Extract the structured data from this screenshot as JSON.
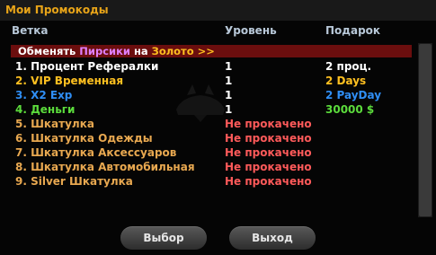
{
  "title": "Мои Промокоды",
  "columns": [
    "Ветка",
    "Уровень",
    "Подарок"
  ],
  "promo": {
    "prefix": "Обменять ",
    "from": "Пирсики",
    "middle": " на ",
    "to": "Золото",
    "suffix": " >>",
    "colors": {
      "prefix": "#ffffff",
      "from": "#e080ff",
      "middle": "#ffffff",
      "to": "#ffc020",
      "suffix": "#ffc020"
    }
  },
  "rows": [
    {
      "branch": "1. Процент Рефералки",
      "level": "1",
      "gift": "2 проц.",
      "branch_color": "#ffffff",
      "level_color": "#ffffff",
      "gift_color": "#ffffff"
    },
    {
      "branch": "2. VIP Временная",
      "level": "1",
      "gift": "2 Days",
      "branch_color": "#ffc020",
      "level_color": "#ffffff",
      "gift_color": "#ffc020"
    },
    {
      "branch": "3. X2 Exp",
      "level": "1",
      "gift": "2 PayDay",
      "branch_color": "#2f8ef5",
      "level_color": "#ffffff",
      "gift_color": "#2f8ef5"
    },
    {
      "branch": "4. Деньги",
      "level": "1",
      "gift": "30000 $",
      "branch_color": "#5cdc3c",
      "level_color": "#ffffff",
      "gift_color": "#5cdc3c"
    },
    {
      "branch": "5. Шкатулка",
      "level": "Не прокачено",
      "gift": "",
      "branch_color": "#e8a850",
      "level_color": "#ff5a5a",
      "gift_color": "#ffffff"
    },
    {
      "branch": "6. Шкатулка Одежды",
      "level": "Не прокачено",
      "gift": "",
      "branch_color": "#e8a850",
      "level_color": "#ff5a5a",
      "gift_color": "#ffffff"
    },
    {
      "branch": "7. Шкатулка Аксессуаров",
      "level": "Не прокачено",
      "gift": "",
      "branch_color": "#e8a850",
      "level_color": "#ff5a5a",
      "gift_color": "#ffffff"
    },
    {
      "branch": "8. Шкатулка Автомобильная",
      "level": "Не прокачено",
      "gift": "",
      "branch_color": "#e8a850",
      "level_color": "#ff5a5a",
      "gift_color": "#ffffff"
    },
    {
      "branch": "9. Silver Шкатулка",
      "level": "Не прокачено",
      "gift": "",
      "branch_color": "#e8a850",
      "level_color": "#ff5a5a",
      "gift_color": "#ffffff"
    }
  ],
  "buttons": {
    "select": "Выбор",
    "exit": "Выход"
  },
  "icons": {
    "watermark": "car-silhouette-icon"
  }
}
